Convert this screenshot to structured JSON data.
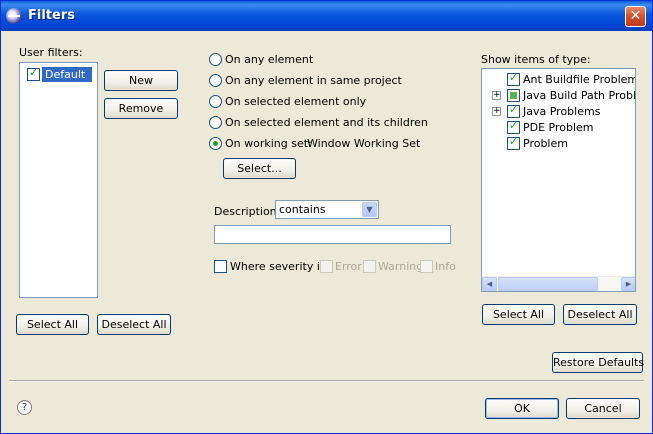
{
  "window": {
    "title": "Filters",
    "close_glyph": "✕"
  },
  "user_filters": {
    "label": "User filters:",
    "items": [
      {
        "label": "Default",
        "checked": true,
        "selected": true
      }
    ],
    "new_button": "New",
    "remove_button": "Remove",
    "select_all_button": "Select All",
    "deselect_all_button": "Deselect All"
  },
  "scope": {
    "options": [
      {
        "label": "On any element",
        "selected": false
      },
      {
        "label": "On any element in same project",
        "selected": false
      },
      {
        "label": "On selected element only",
        "selected": false
      },
      {
        "label": "On selected element and its children",
        "selected": false
      },
      {
        "label": "On working set:",
        "selected": true
      }
    ],
    "working_set_value": "Window Working Set",
    "select_button": "Select..."
  },
  "description": {
    "label": "Description",
    "operator": "contains",
    "value": ""
  },
  "severity": {
    "label": "Where severity is",
    "checked": false,
    "options": [
      {
        "label": "Error",
        "checked": false,
        "enabled": false
      },
      {
        "label": "Warning",
        "checked": false,
        "enabled": false
      },
      {
        "label": "Info",
        "checked": false,
        "enabled": false
      }
    ]
  },
  "types": {
    "label": "Show items of type:",
    "items": [
      {
        "label": "Ant Buildfile Problem",
        "checked": true,
        "expandable": false
      },
      {
        "label": "Java Build Path Problems",
        "checked": "partial",
        "expandable": true
      },
      {
        "label": "Java Problems",
        "checked": true,
        "expandable": true
      },
      {
        "label": "PDE Problem",
        "checked": true,
        "expandable": false
      },
      {
        "label": "Problem",
        "checked": true,
        "expandable": false
      }
    ],
    "select_all_button": "Select All",
    "deselect_all_button": "Deselect All"
  },
  "footer": {
    "restore_defaults_button": "Restore Defaults",
    "ok_button": "OK",
    "cancel_button": "Cancel",
    "help_glyph": "?"
  },
  "colors": {
    "titlebar": "#0855dd",
    "window_bg": "#ece9d8",
    "selection": "#316ac5",
    "check": "#21a121"
  }
}
